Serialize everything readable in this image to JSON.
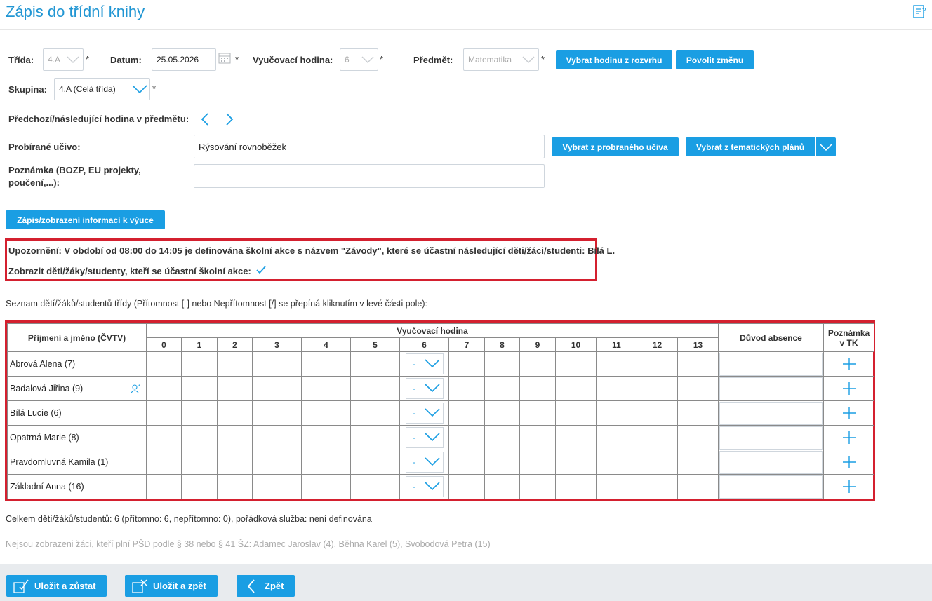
{
  "page": {
    "title": "Zápis do třídní knihy",
    "help_icon": "help-document-icon"
  },
  "form": {
    "trida_label": "Třída:",
    "trida_value": "4.A",
    "datum_label": "Datum:",
    "datum_value": "25.05.2026",
    "hodina_label": "Vyučovací hodina:",
    "hodina_value": "6",
    "predmet_label": "Předmět:",
    "predmet_value": "Matematika",
    "required_mark": "*",
    "btn_rozvrh": "Vybrat hodinu z rozvrhu",
    "btn_zmena": "Povolit změnu",
    "skupina_label": "Skupina:",
    "skupina_value": "4.A (Celá třída)",
    "prev_next_label": "Předchozí/následující hodina v předmětu:",
    "ucivo_label": "Probírané učivo:",
    "ucivo_value": "Rýsování rovnoběžek",
    "btn_probrane": "Vybrat z probraného učiva",
    "btn_tematicke": "Vybrat z tematických plánů",
    "poznamka_label_1": "Poznámka (BOZP, EU projekty,",
    "poznamka_label_2": "poučení,...):",
    "poznamka_value": "",
    "btn_info_vyuka": "Zápis/zobrazení informací k výuce"
  },
  "warning": {
    "prefix": "Upozornění:",
    "text": "V období od 08:00 do 14:05 je definována školní akce s názvem \"Závody\", které se účastní následující děti/žáci/studenti: Bílá L.",
    "show_label": "Zobrazit děti/žáky/studenty, kteří se účastní školní akce:"
  },
  "list_intro": "Seznam dětí/žáků/studentů třídy (Přítomnost [-] nebo Nepřítomnost [/] se přepíná kliknutím v levé části pole):",
  "table": {
    "col_name": "Příjmení a jméno (ČVTV)",
    "col_hours": "Vyučovací hodina",
    "hours": [
      "0",
      "1",
      "2",
      "3",
      "4",
      "5",
      "6",
      "7",
      "8",
      "9",
      "10",
      "11",
      "12",
      "13"
    ],
    "col_reason": "Důvod absence",
    "col_note_1": "Poznámka",
    "col_note_2": "v TK",
    "attendance_symbol": "-",
    "students": [
      {
        "name": "Abrová Alena (7)",
        "badge": false
      },
      {
        "name": "Badalová Jiřina (9)",
        "badge": true
      },
      {
        "name": "Bílá Lucie (6)",
        "badge": false
      },
      {
        "name": "Opatrná Marie (8)",
        "badge": false
      },
      {
        "name": "Pravdomluvná Kamila (1)",
        "badge": false
      },
      {
        "name": "Základní Anna (16)",
        "badge": false
      }
    ]
  },
  "summary": "Celkem dětí/žáků/studentů: 6 (přítomno: 6, nepřítomno: 0), pořádková služba: není definována",
  "psd_note": "Nejsou zobrazeni žáci, kteří plní PŠD podle § 38 nebo § 41 ŠZ: Adamec Jaroslav (4), Běhna Karel (5), Svobodová Petra (15)",
  "footer": {
    "save_stay": "Uložit a zůstat",
    "save_back": "Uložit a zpět",
    "back": "Zpět"
  },
  "colors": {
    "accent": "#1a9ee3",
    "highlight_border": "#d4202f"
  }
}
